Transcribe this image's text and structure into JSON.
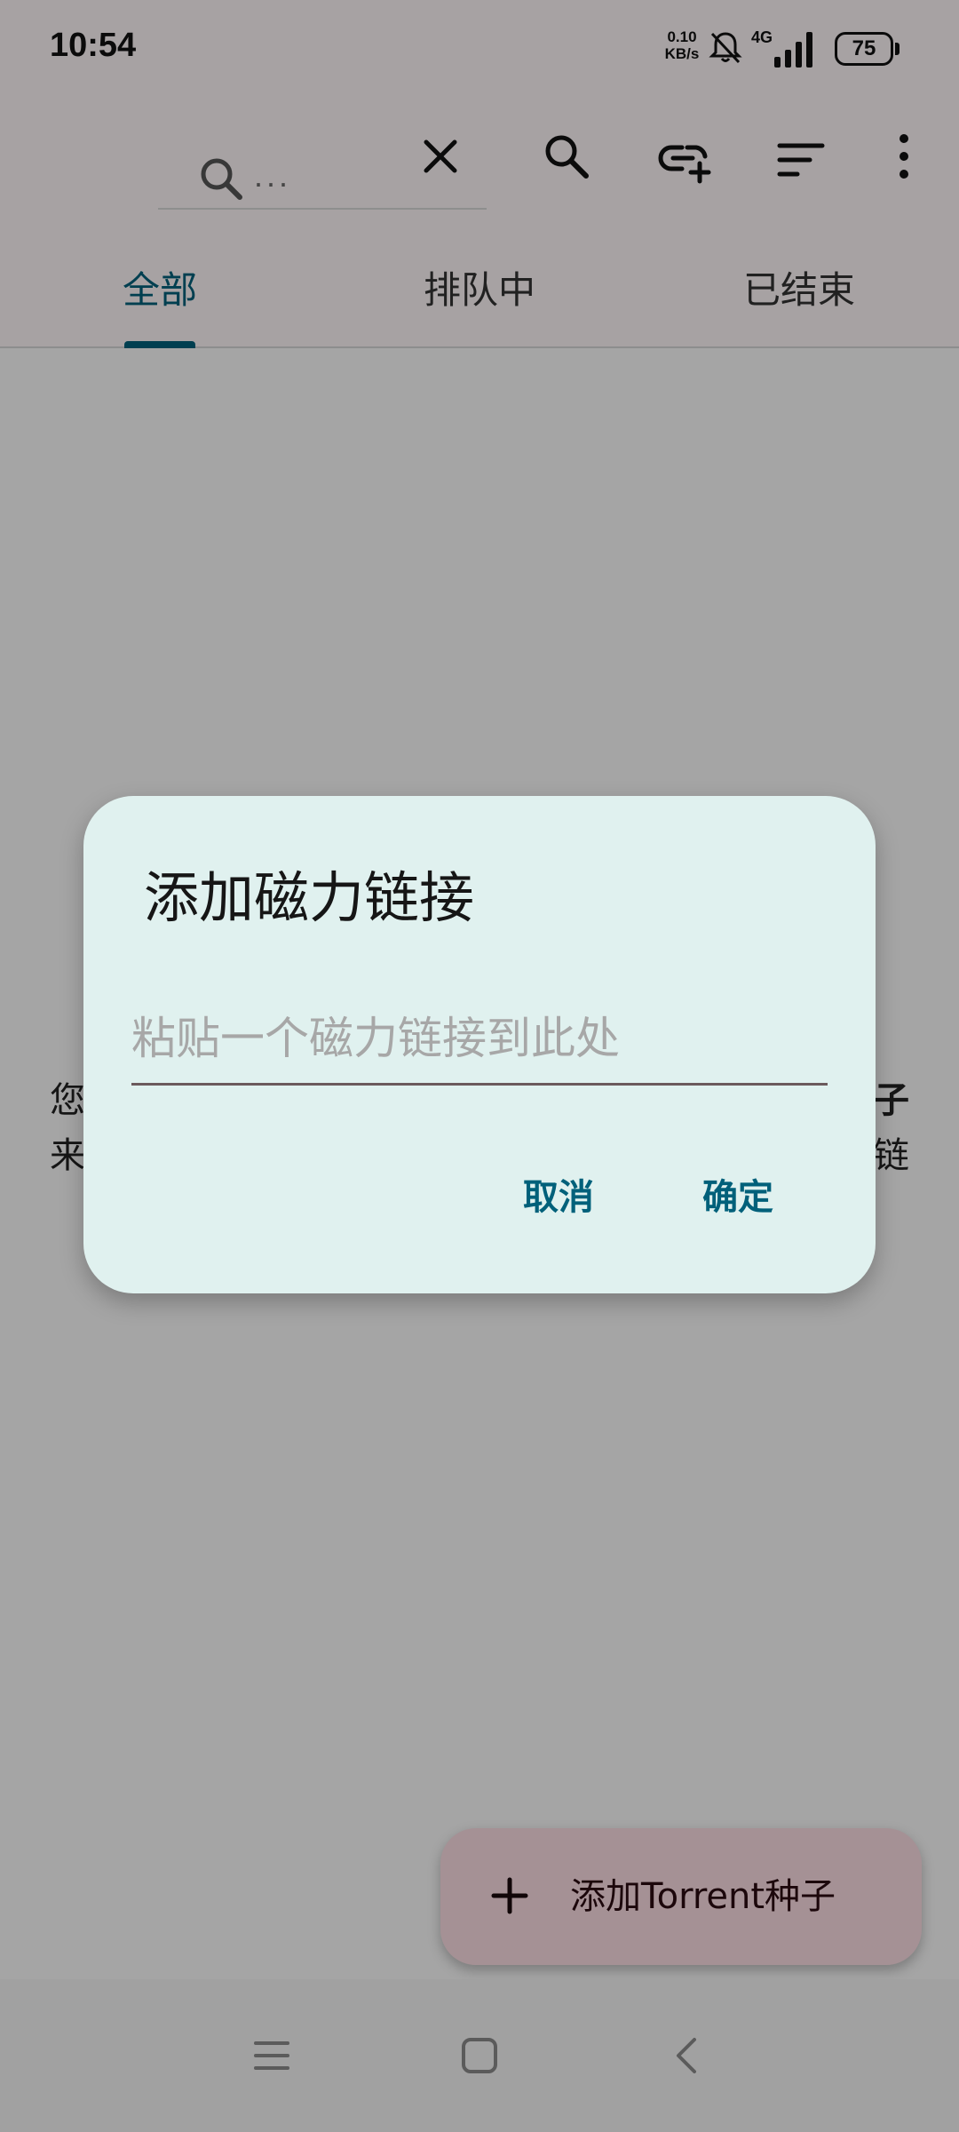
{
  "status_bar": {
    "time": "10:54",
    "net_speed_value": "0.10",
    "net_speed_unit": "KB/s",
    "network_type": "4G",
    "battery_level": "75"
  },
  "toolbar": {
    "search_placeholder": "...",
    "icons": [
      "search-icon",
      "close-icon",
      "search-icon",
      "add-link-icon",
      "sort-icon",
      "more-vert-icon"
    ]
  },
  "tabs": [
    {
      "label": "全部",
      "active": true
    },
    {
      "label": "排队中",
      "active": false
    },
    {
      "label": "已结束",
      "active": false
    }
  ],
  "empty_state": {
    "line1_start": "您",
    "line1_end": "子",
    "line2_start": "来",
    "line2_end": "链"
  },
  "fab": {
    "label": "添加Torrent种子"
  },
  "dialog": {
    "title": "添加磁力链接",
    "input_placeholder": "粘贴一个磁力链接到此处",
    "input_value": "",
    "cancel_label": "取消",
    "confirm_label": "确定"
  },
  "colors": {
    "accent": "#00607a",
    "dialog_bg": "#e0f1ef",
    "fab_bg": "#fbdde3",
    "app_bar_bg": "#fdf6f7"
  }
}
